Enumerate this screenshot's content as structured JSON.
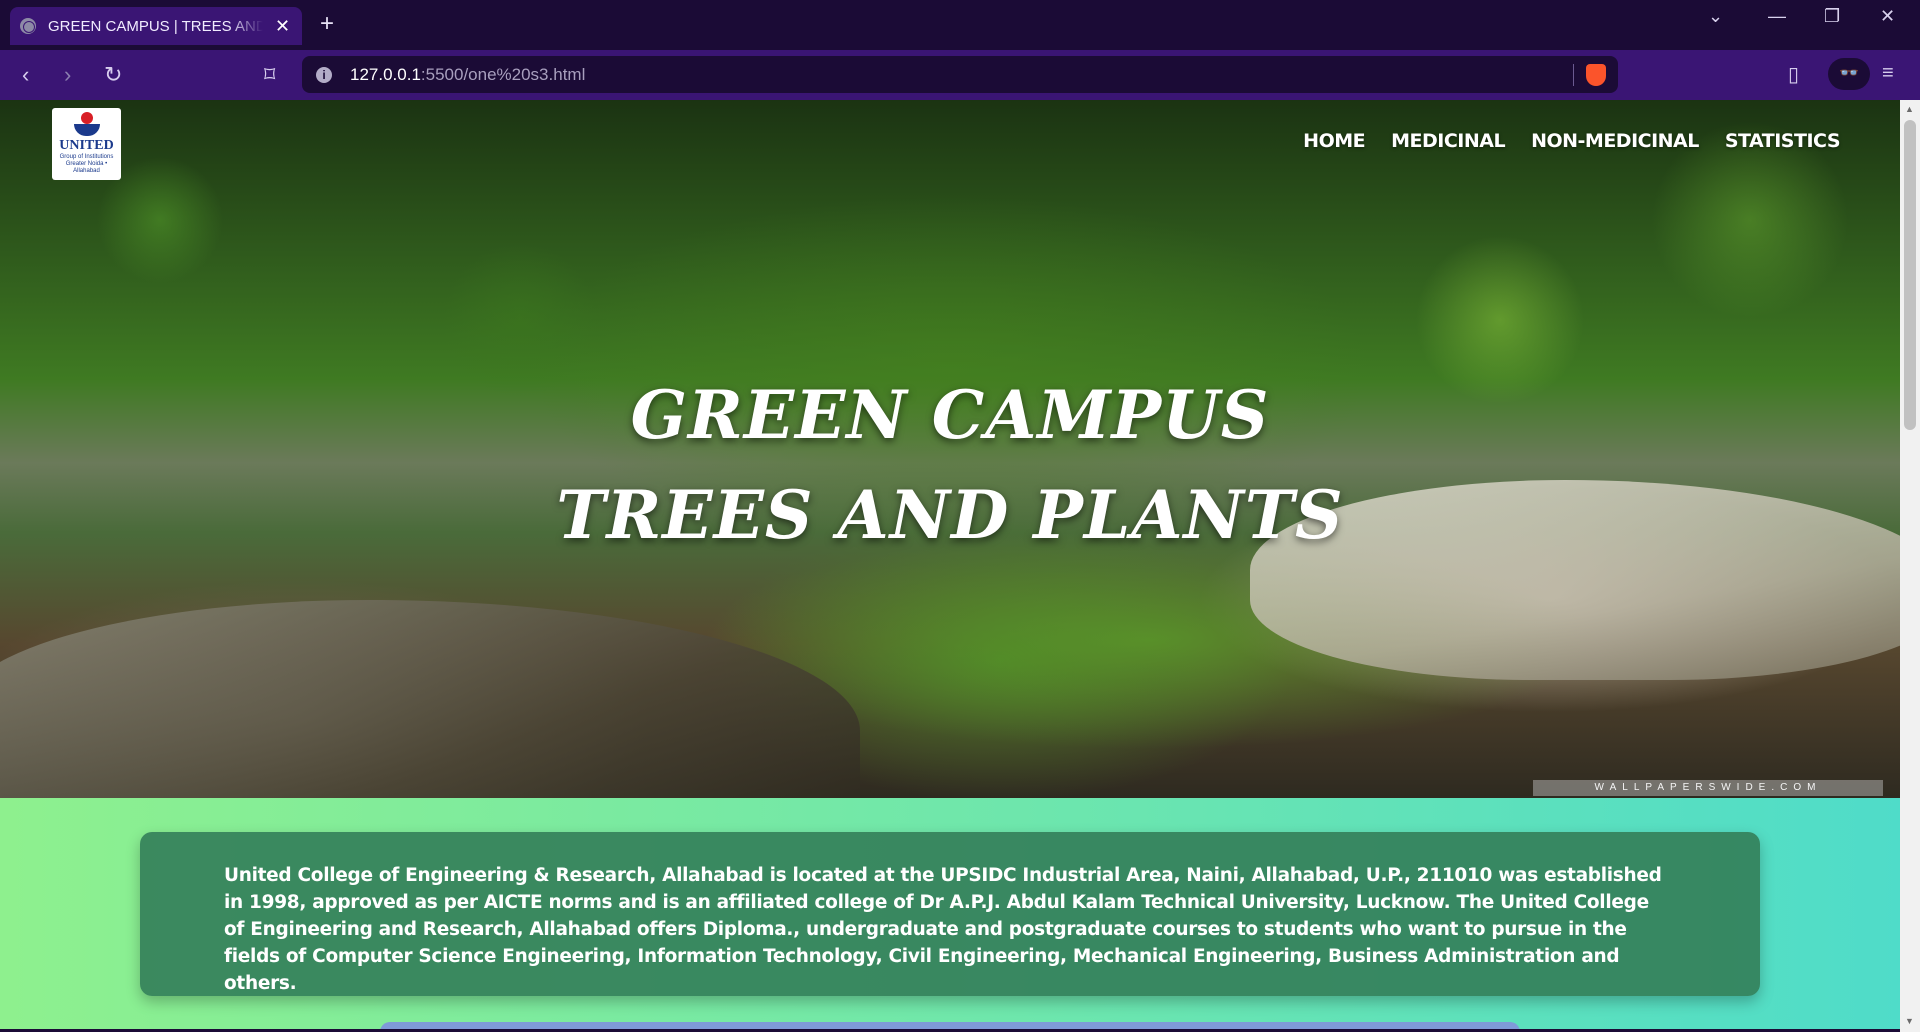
{
  "browser": {
    "tab_title": "GREEN CAMPUS | TREES AND PLANTS",
    "url_host": "127.0.0.1",
    "url_path": ":5500/one%20s3.html"
  },
  "site": {
    "logo_name": "UNITED",
    "logo_sub": "Group of Institutions",
    "logo_tagline": "Greater Noida • Allahabad",
    "nav": [
      "HOME",
      "MEDICINAL",
      "NON-MEDICINAL",
      "STATISTICS"
    ],
    "hero_line1": "GREEN CAMPUS",
    "hero_line2": "TREES AND PLANTS",
    "watermark": "WALLPAPERSWIDE.COM",
    "about_text": "United College of Engineering & Research, Allahabad is located at the UPSIDC Industrial Area, Naini, Allahabad, U.P., 211010 was established in 1998, approved as per AICTE norms and is an affiliated college of Dr A.P.J. Abdul Kalam Technical University, Lucknow. The United College of Engineering and Research, Allahabad offers Diploma., undergraduate and postgraduate courses to students who want to pursue in the fields of Computer Science Engineering, Information Technology, Civil Engineering, Mechanical Engineering, Business Administration and others."
  },
  "colors": {
    "browser_bg": "#1b0b36",
    "toolbar_bg": "#3a1574",
    "about_bg": "#34805a",
    "page_gradient_start": "#8ef08e",
    "page_gradient_end": "#4fdcc9"
  }
}
